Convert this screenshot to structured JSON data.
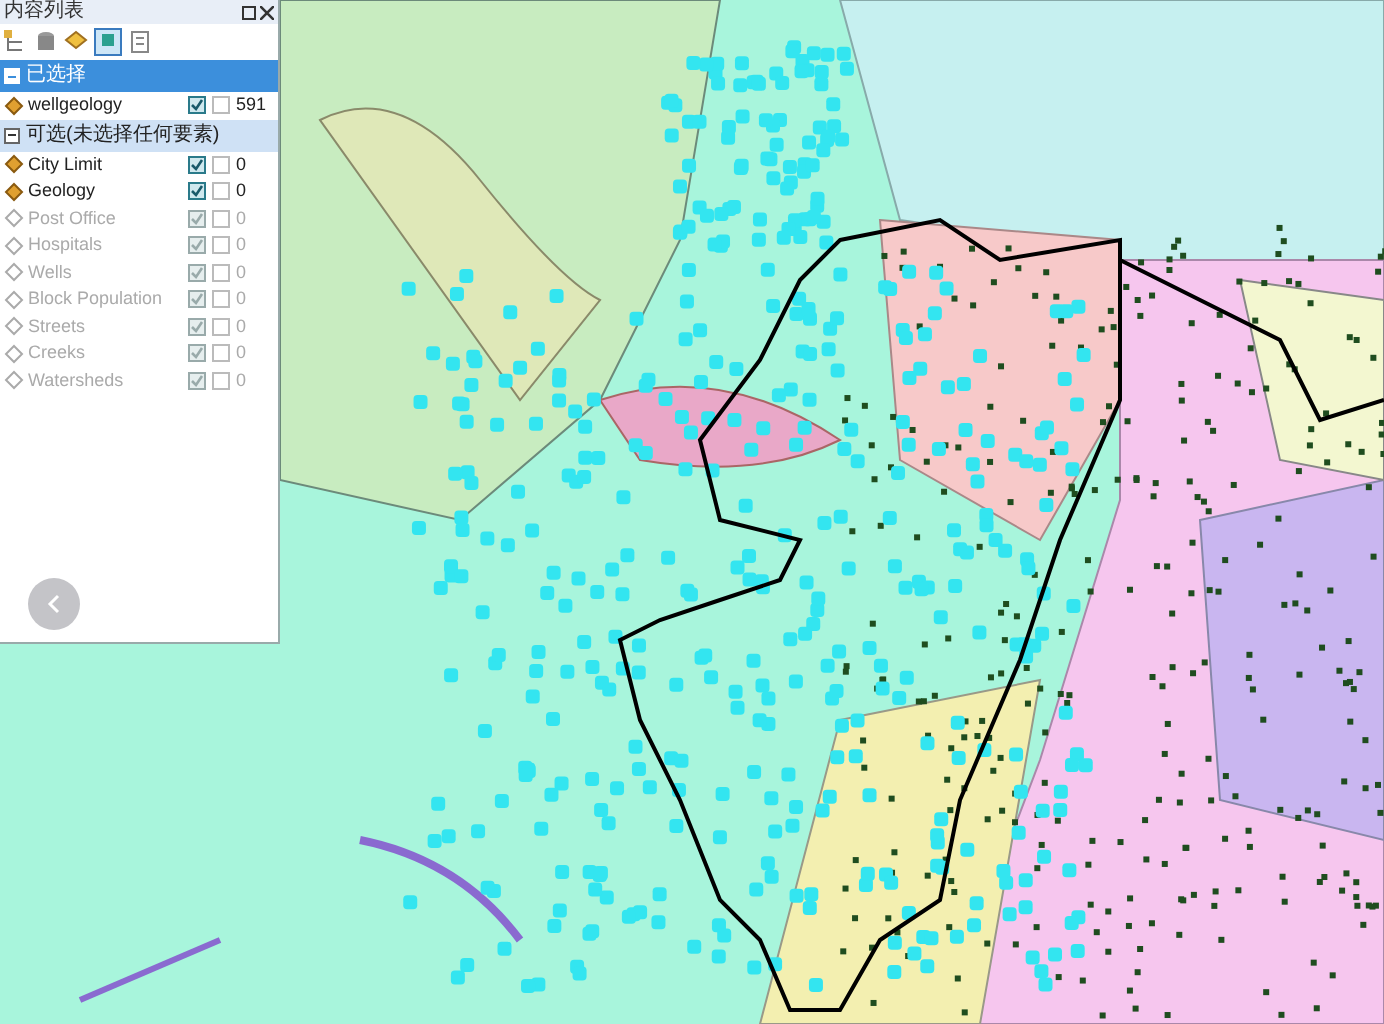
{
  "panel": {
    "title": "内容列表"
  },
  "groups": [
    {
      "label": "已选择",
      "selected": true,
      "expanded": true,
      "layers": [
        {
          "name": "wellgeology",
          "selectable": true,
          "visible": true,
          "option_checked": false,
          "count": "591"
        }
      ]
    },
    {
      "label": "可选(未选择任何要素)",
      "selected": false,
      "expanded": true,
      "layers": [
        {
          "name": "City Limit",
          "selectable": true,
          "visible": true,
          "option_checked": false,
          "count": "0"
        },
        {
          "name": "Geology",
          "selectable": true,
          "visible": true,
          "option_checked": false,
          "count": "0"
        },
        {
          "name": "Post Office",
          "selectable": false,
          "visible": true,
          "option_checked": false,
          "count": "0"
        },
        {
          "name": "Hospitals",
          "selectable": false,
          "visible": true,
          "option_checked": false,
          "count": "0"
        },
        {
          "name": "Wells",
          "selectable": false,
          "visible": true,
          "option_checked": false,
          "count": "0"
        },
        {
          "name": "Block Population",
          "selectable": false,
          "visible": true,
          "option_checked": false,
          "count": "0"
        },
        {
          "name": "Streets",
          "selectable": false,
          "visible": true,
          "option_checked": false,
          "count": "0"
        },
        {
          "name": "Creeks",
          "selectable": false,
          "visible": true,
          "option_checked": false,
          "count": "0"
        },
        {
          "name": "Watersheds",
          "selectable": false,
          "visible": true,
          "option_checked": false,
          "count": "0"
        }
      ]
    }
  ]
}
